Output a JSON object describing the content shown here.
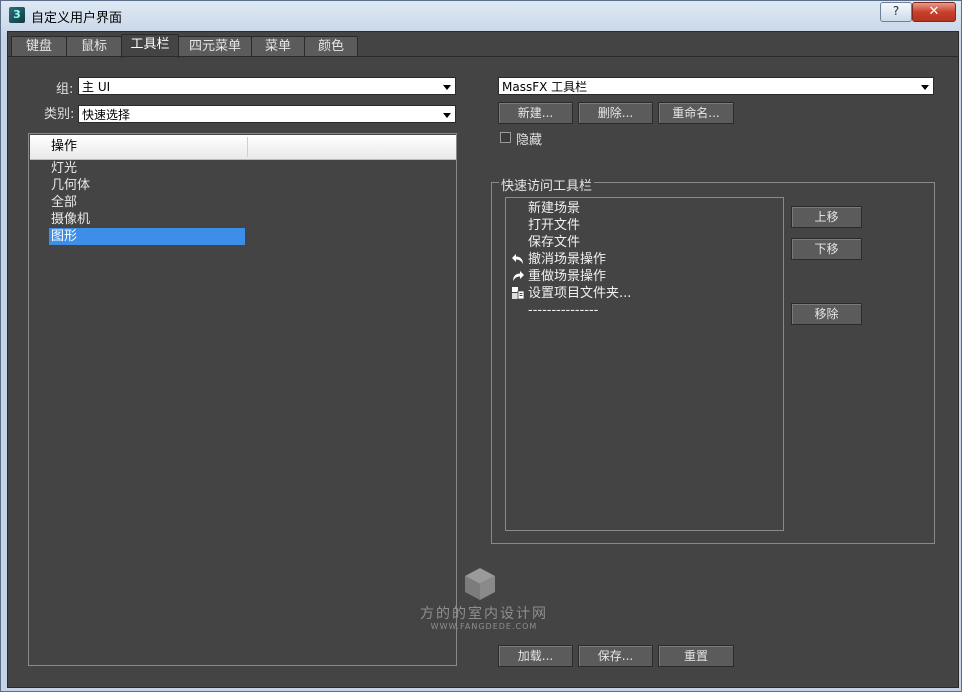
{
  "window": {
    "title": "自定义用户界面",
    "help_label": "?",
    "close_label": "✕"
  },
  "tabs": [
    {
      "label": "键盘"
    },
    {
      "label": "鼠标"
    },
    {
      "label": "工具栏"
    },
    {
      "label": "四元菜单"
    },
    {
      "label": "菜单"
    },
    {
      "label": "颜色"
    }
  ],
  "active_tab": "工具栏",
  "left_panel": {
    "group_label": "组:",
    "group_value": "主 UI",
    "category_label": "类别:",
    "category_value": "快速选择",
    "list": {
      "column_header": "操作",
      "items": [
        "灯光",
        "几何体",
        "全部",
        "摄像机",
        "图形"
      ],
      "selected": "图形"
    }
  },
  "right_panel": {
    "toolbar_select_value": "MassFX 工具栏",
    "buttons": {
      "new": "新建...",
      "delete": "删除...",
      "rename": "重命名..."
    },
    "hide_label": "隐藏",
    "hide_checked": false,
    "quick_access": {
      "title": "快速访问工具栏",
      "items": [
        {
          "label": "新建场景",
          "icon": ""
        },
        {
          "label": "打开文件",
          "icon": ""
        },
        {
          "label": "保存文件",
          "icon": ""
        },
        {
          "label": "撤消场景操作",
          "icon": "undo-icon"
        },
        {
          "label": "重做场景操作",
          "icon": "redo-icon"
        },
        {
          "label": "设置项目文件夹...",
          "icon": "project-folder-icon"
        },
        {
          "label": "---------------",
          "icon": ""
        }
      ],
      "move_up": "上移",
      "move_down": "下移",
      "remove": "移除"
    }
  },
  "bottom_buttons": {
    "load": "加载...",
    "save": "保存...",
    "reset": "重置"
  },
  "watermark": {
    "text": "方的的室内设计网",
    "sub": "WWW.FANGDEDE.COM"
  }
}
